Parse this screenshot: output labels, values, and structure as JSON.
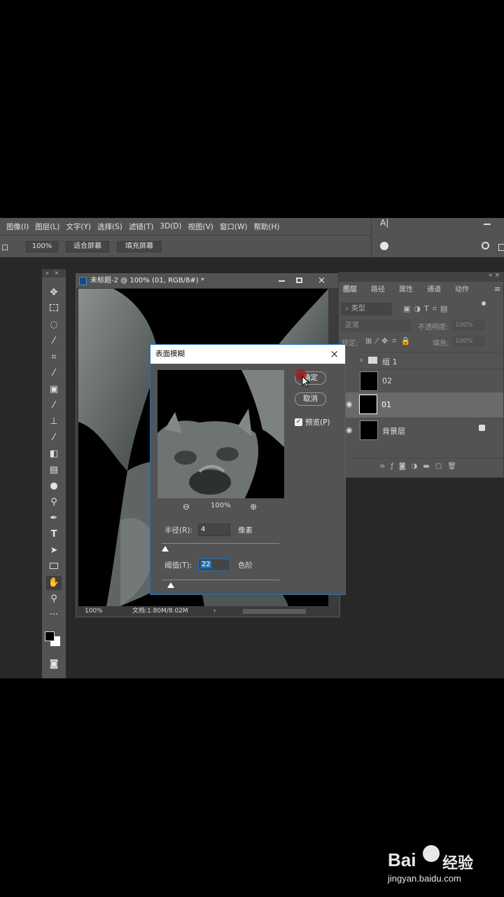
{
  "menu": [
    "图像(I)",
    "图层(L)",
    "文字(Y)",
    "选择(S)",
    "滤镜(T)",
    "3D(D)",
    "视图(V)",
    "窗口(W)",
    "帮助(H)"
  ],
  "options": {
    "left_label": "口",
    "zoom": "100%",
    "fit_screen": "适合屏幕",
    "fill_screen": "填充屏幕"
  },
  "document": {
    "title": "未标题-2 @ 100% (01, RGB/8#) *",
    "zoom": "100%",
    "doc_info": "文档:1.80M/8.02M"
  },
  "layers_panel": {
    "tabs": [
      "图层",
      "路径",
      "属性",
      "通道",
      "动作"
    ],
    "kind_filter": "类型",
    "blend_mode": "正常",
    "opacity_label": "不透明度:",
    "opacity": "100%",
    "lock_label": "锁定:",
    "fill_label": "填充:",
    "fill": "100%",
    "layers": [
      {
        "name": "组 1"
      },
      {
        "name": "02"
      },
      {
        "name": "01"
      },
      {
        "name": "背景层"
      }
    ]
  },
  "dialog": {
    "title": "表面模糊",
    "ok": "确定",
    "cancel": "取消",
    "preview_label": "预览(P)",
    "preview_checked": true,
    "zoom": "100%",
    "radius_label": "半径(R):",
    "radius_value": "4",
    "radius_unit": "像素",
    "threshold_label": "阈值(T):",
    "threshold_value": "22",
    "threshold_unit": "色阶",
    "radius_slider_fraction": 0.03,
    "threshold_slider_fraction": 0.08
  },
  "watermark": {
    "brand": "Bai",
    "brand_suffix": "经验",
    "url": "jingyan.baidu.com"
  },
  "colors": {
    "panel": "#535353",
    "workspace": "#282828",
    "selection": "#1e73be"
  }
}
